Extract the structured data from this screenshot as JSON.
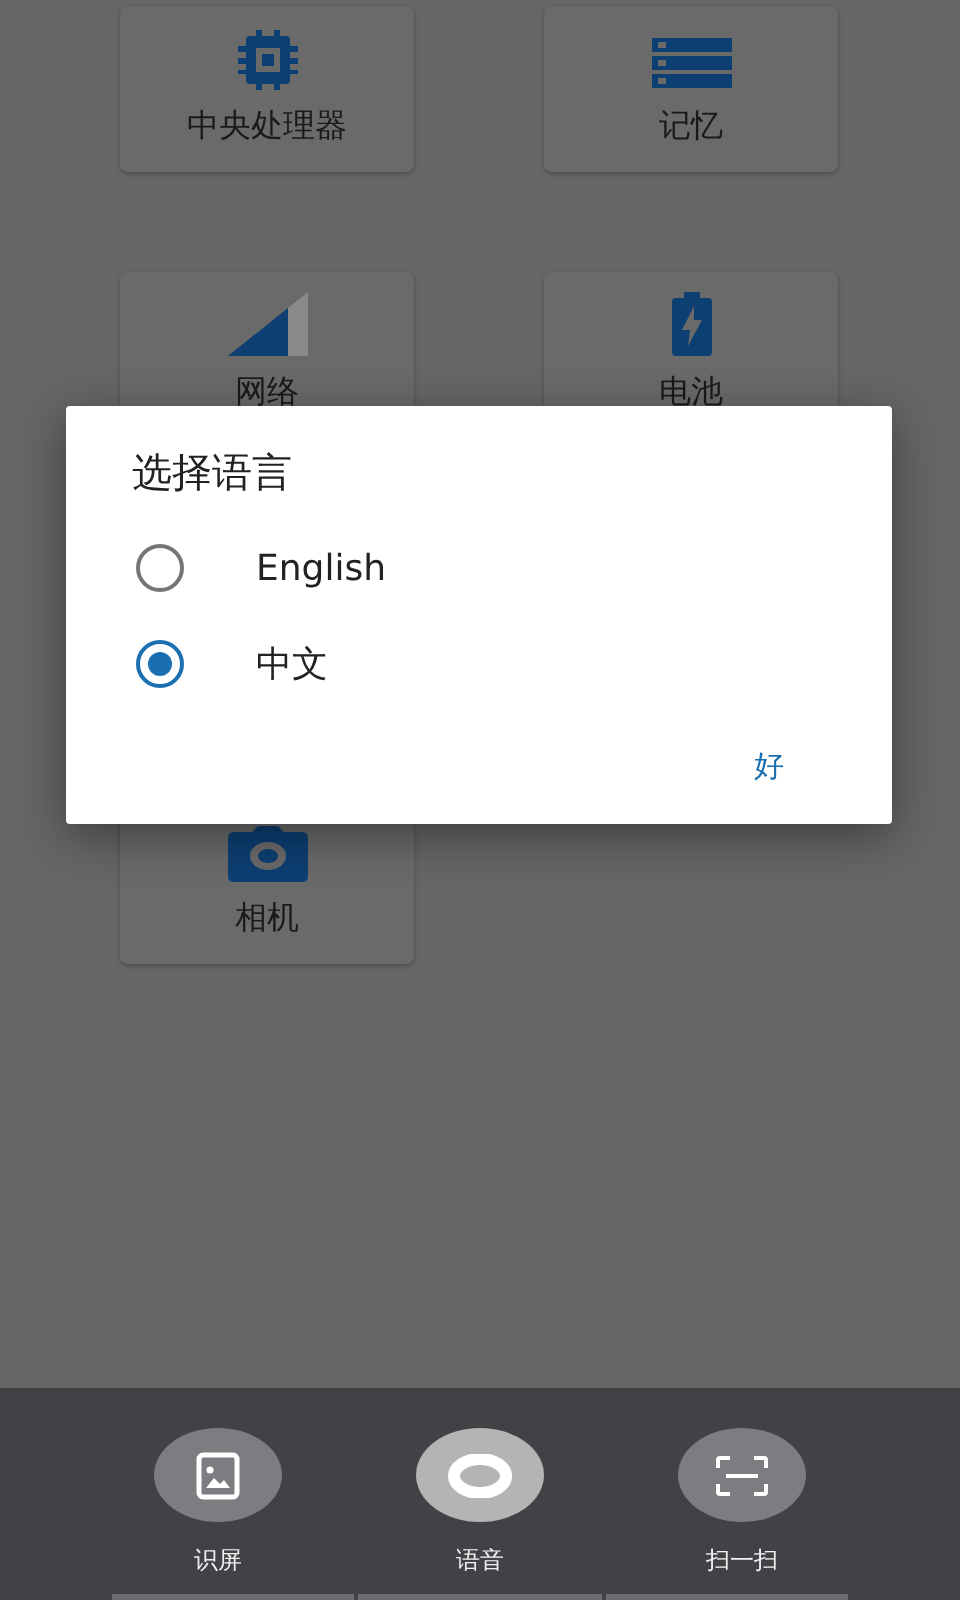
{
  "cards": [
    {
      "kind": "cpu",
      "label": "中央处理器"
    },
    {
      "kind": "memory",
      "label": "记忆"
    },
    {
      "kind": "network",
      "label": "网络"
    },
    {
      "kind": "battery",
      "label": "电池"
    },
    {
      "kind": "camera",
      "label": "相机"
    }
  ],
  "dialog": {
    "title": "选择语言",
    "options": [
      {
        "label": "English",
        "selected": false
      },
      {
        "label": "中文",
        "selected": true
      }
    ],
    "button": "好"
  },
  "bottom_bar": [
    {
      "kind": "image",
      "label": "识屏",
      "selected": false
    },
    {
      "kind": "ring",
      "label": "语音",
      "selected": true
    },
    {
      "kind": "scan",
      "label": "扫一扫",
      "selected": false
    }
  ]
}
